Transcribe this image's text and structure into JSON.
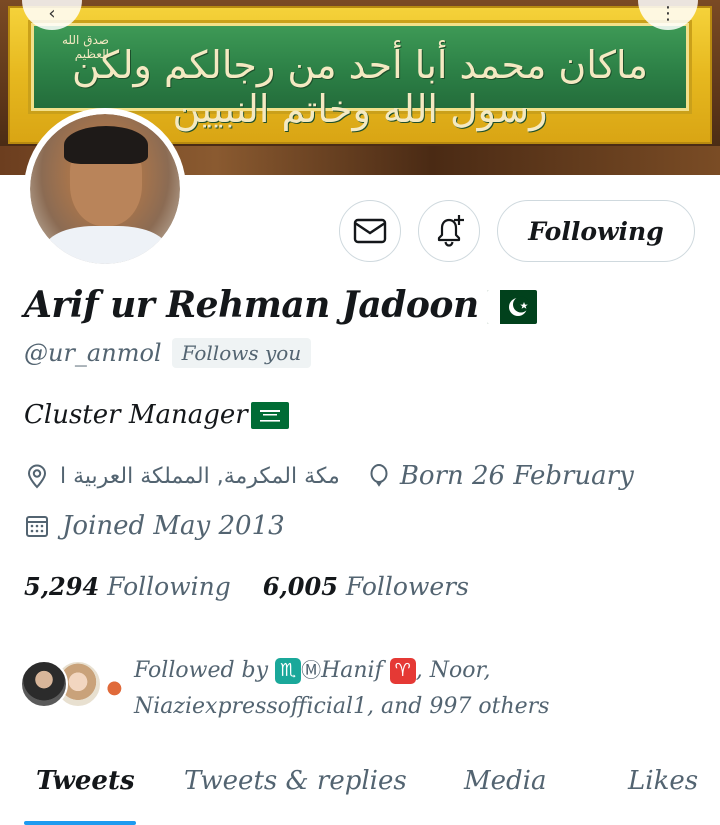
{
  "banner": {
    "calligraphy": "ماكان محمد أبا أحد من رجالكم ولكن رسول الله وخاتم النبيين",
    "small_calligraphy": "صدق الله العظيم"
  },
  "profile": {
    "name": "Arif ur Rehman Jadoon",
    "name_flag": "pakistan-flag-icon",
    "handle": "@ur_anmol",
    "follows_you": "Follows you",
    "bio": "Cluster Manager",
    "bio_flag": "saudi-arabia-flag-icon",
    "location": "مكة المكرمة, المملكة العربية ا",
    "birthday": "Born 26 February",
    "joined": "Joined May 2013"
  },
  "buttons": {
    "message_icon": "envelope-icon",
    "notify_icon": "bell-plus-icon",
    "following_label": "Following"
  },
  "stats": {
    "following_count": "5,294",
    "following_label": "Following",
    "followers_count": "6,005",
    "followers_label": "Followers"
  },
  "followed_by": {
    "prefix": "Followed by",
    "name1_symbol": "♏",
    "name1_prefix": "Ⓜ",
    "name1": "Hanif",
    "name1_suffix": "♈",
    "separator": ",",
    "name2": "Noor,",
    "line2": "Niaziexpressofficial1, and 997 others"
  },
  "tabs": [
    {
      "label": "Tweets",
      "active": true
    },
    {
      "label": "Tweets & replies",
      "active": false
    },
    {
      "label": "Media",
      "active": false
    },
    {
      "label": "Likes",
      "active": false
    }
  ],
  "colors": {
    "accent": "#1d9bf0",
    "secondary_text": "#536471",
    "primary_text": "#14171a"
  }
}
